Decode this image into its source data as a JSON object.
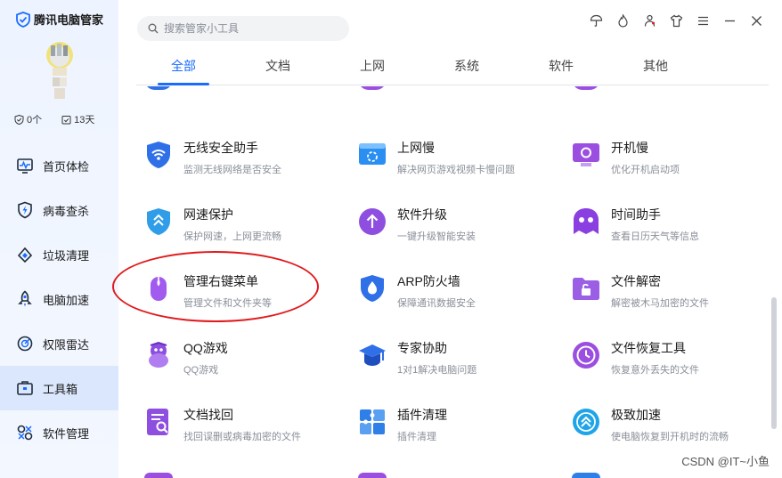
{
  "app": {
    "title": "腾讯电脑管家"
  },
  "user": {
    "stat_count": "0个",
    "stat_days": "13天"
  },
  "sidebar": {
    "items": [
      {
        "label": "首页体检",
        "icon": "monitor-wave-icon"
      },
      {
        "label": "病毒查杀",
        "icon": "shield-lightning-icon"
      },
      {
        "label": "垃圾清理",
        "icon": "broom-icon"
      },
      {
        "label": "电脑加速",
        "icon": "rocket-icon"
      },
      {
        "label": "权限雷达",
        "icon": "radar-icon"
      },
      {
        "label": "工具箱",
        "icon": "toolbox-icon",
        "active": true
      },
      {
        "label": "软件管理",
        "icon": "apps-icon"
      }
    ]
  },
  "search": {
    "placeholder": "搜索管家小工具"
  },
  "tabs": [
    "全部",
    "文档",
    "上网",
    "系统",
    "软件",
    "其他"
  ],
  "tools": [
    {
      "name": "无线安全助手",
      "desc": "监测无线网络是否安全",
      "icon": "wifi-shield-icon",
      "color": "#2f6fe8"
    },
    {
      "name": "上网慢",
      "desc": "解决网页游戏视频卡慢问题",
      "icon": "slow-network-icon",
      "color": "#2a8ff0"
    },
    {
      "name": "开机慢",
      "desc": "优化开机启动项",
      "icon": "slow-boot-icon",
      "color": "#9b4fe0"
    },
    {
      "name": "网速保护",
      "desc": "保护网速，上网更流畅",
      "icon": "speed-shield-icon",
      "color": "#2f9de8"
    },
    {
      "name": "软件升级",
      "desc": "一键升级智能安装",
      "icon": "upgrade-arrow-icon",
      "color": "#8e4fe0"
    },
    {
      "name": "时间助手",
      "desc": "查看日历天气等信息",
      "icon": "time-assistant-icon",
      "color": "#8a3fe0"
    },
    {
      "name": "管理右键菜单",
      "desc": "管理文件和文件夹等",
      "icon": "mouse-icon",
      "color": "#a25bef"
    },
    {
      "name": "ARP防火墙",
      "desc": "保障通讯数据安全",
      "icon": "firewall-shield-icon",
      "color": "#2f6fe8"
    },
    {
      "name": "文件解密",
      "desc": "解密被木马加密的文件",
      "icon": "folder-unlock-icon",
      "color": "#9b5fe6"
    },
    {
      "name": "QQ游戏",
      "desc": "QQ游戏",
      "icon": "qq-penguin-icon",
      "color": "#8d4fe0"
    },
    {
      "name": "专家协助",
      "desc": "1对1解决电脑问题",
      "icon": "expert-cap-icon",
      "color": "#2f6fe8"
    },
    {
      "name": "文件恢复工具",
      "desc": "恢复意外丢失的文件",
      "icon": "file-restore-icon",
      "color": "#9b4fe0"
    },
    {
      "name": "文档找回",
      "desc": "找回误删或病毒加密的文件",
      "icon": "doc-search-icon",
      "color": "#8e4fe0"
    },
    {
      "name": "插件清理",
      "desc": "插件清理",
      "icon": "plugin-puzzle-icon",
      "color": "#2f7fe8"
    },
    {
      "name": "极致加速",
      "desc": "使电脑恢复到开机时的流畅",
      "icon": "extreme-speed-icon",
      "color": "#1ea5e8"
    }
  ],
  "watermark": "CSDN @IT~小鱼",
  "colors": {
    "accent": "#1a6cff",
    "annotation": "#e0191c",
    "sidebar_active": "#dbe7fc"
  }
}
